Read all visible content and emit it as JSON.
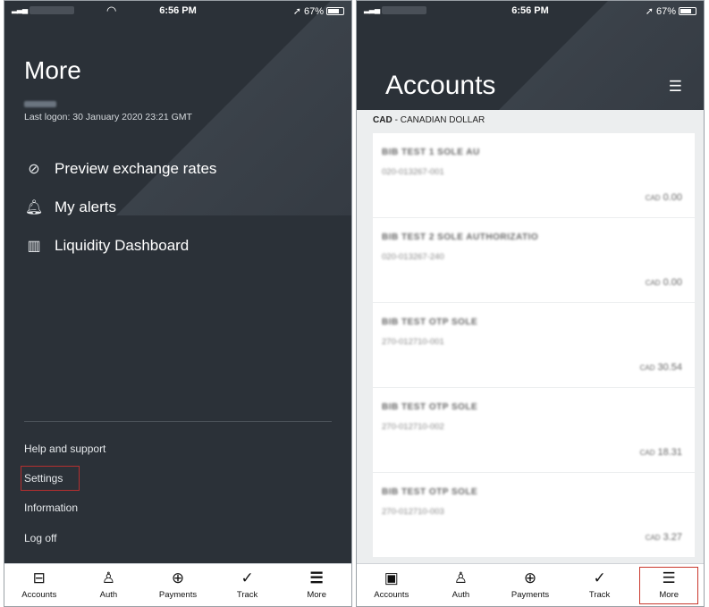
{
  "status": {
    "time": "6:56 PM",
    "battery": "67%"
  },
  "more_screen": {
    "title": "More",
    "last_logon": "Last logon: 30 January 2020 23:21 GMT",
    "menu": [
      {
        "label": "Preview exchange rates",
        "icon": "exchange-rate-icon"
      },
      {
        "label": "My alerts",
        "icon": "bell-icon"
      },
      {
        "label": "Liquidity Dashboard",
        "icon": "dashboard-chart-icon"
      }
    ],
    "links": [
      "Help and support",
      "Settings",
      "Information",
      "Log off"
    ],
    "highlighted_link": "Settings"
  },
  "accounts_screen": {
    "title": "Accounts",
    "currency_code": "CAD",
    "currency_name": "- CANADIAN DOLLAR",
    "accounts": [
      {
        "name": "BIB TEST 1 SOLE AU",
        "number": "020-013267-001",
        "currency": "CAD",
        "balance": "0.00"
      },
      {
        "name": "BIB TEST 2 SOLE AUTHORIZATIO",
        "number": "020-013267-240",
        "currency": "CAD",
        "balance": "0.00"
      },
      {
        "name": "BIB TEST OTP SOLE",
        "number": "270-012710-001",
        "currency": "CAD",
        "balance": "30.54"
      },
      {
        "name": "BIB TEST OTP SOLE",
        "number": "270-012710-002",
        "currency": "CAD",
        "balance": "18.31"
      },
      {
        "name": "BIB TEST OTP SOLE",
        "number": "270-012710-003",
        "currency": "CAD",
        "balance": "3.27"
      }
    ]
  },
  "nav": [
    {
      "label": "Accounts",
      "icon": "accounts-icon"
    },
    {
      "label": "Auth",
      "icon": "auth-stamp-icon"
    },
    {
      "label": "Payments",
      "icon": "payments-icon"
    },
    {
      "label": "Track",
      "icon": "track-icon"
    },
    {
      "label": "More",
      "icon": "menu-icon"
    }
  ],
  "colors": {
    "dark_bg": "#2b3138",
    "highlight": "#c9372c"
  }
}
